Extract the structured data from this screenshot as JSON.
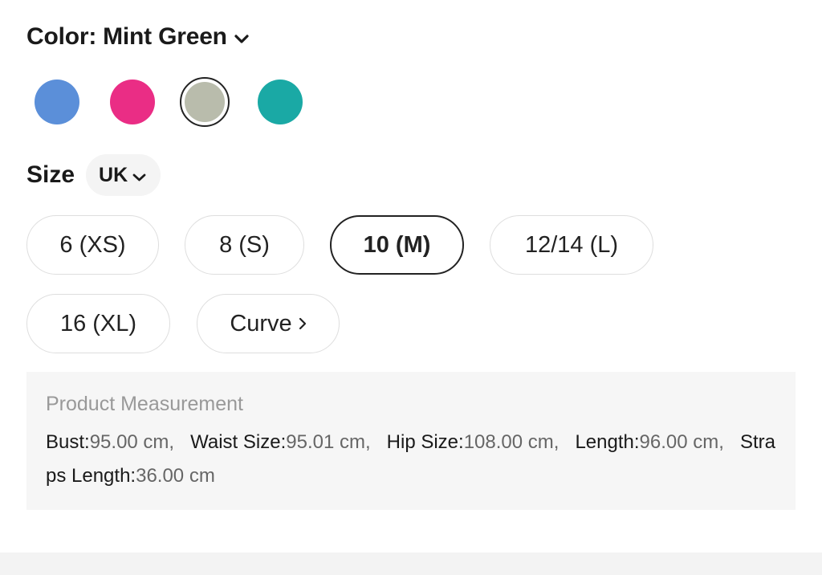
{
  "color": {
    "label": "Color:",
    "selected_name": "Mint Green",
    "dropdown_icon": "chevron-down-icon",
    "swatches": [
      {
        "color": "#5b8fd9",
        "selected": false
      },
      {
        "color": "#ea2d85",
        "selected": false
      },
      {
        "color": "#b9bcac",
        "selected": true
      },
      {
        "color": "#1aa9a5",
        "selected": false
      }
    ]
  },
  "size": {
    "title": "Size",
    "unit": "UK",
    "unit_icon": "chevron-down-icon",
    "options": [
      {
        "label": "6 (XS)",
        "selected": false
      },
      {
        "label": "8 (S)",
        "selected": false
      },
      {
        "label": "10 (M)",
        "selected": true
      },
      {
        "label": "12/14 (L)",
        "selected": false
      },
      {
        "label": "16 (XL)",
        "selected": false
      },
      {
        "label": "Curve",
        "selected": false,
        "icon": "chevron-right-icon"
      }
    ]
  },
  "measurement": {
    "title": "Product Measurement",
    "items": [
      {
        "key": "Bust:",
        "value": "95.00 cm,"
      },
      {
        "key": "Waist Size:",
        "value": "95.01 cm,"
      },
      {
        "key": "Hip Size:",
        "value": "108.00 cm,"
      },
      {
        "key": "Length:",
        "value": "96.00 cm,"
      },
      {
        "key": "Straps Length:",
        "value": "36.00 cm"
      }
    ]
  }
}
